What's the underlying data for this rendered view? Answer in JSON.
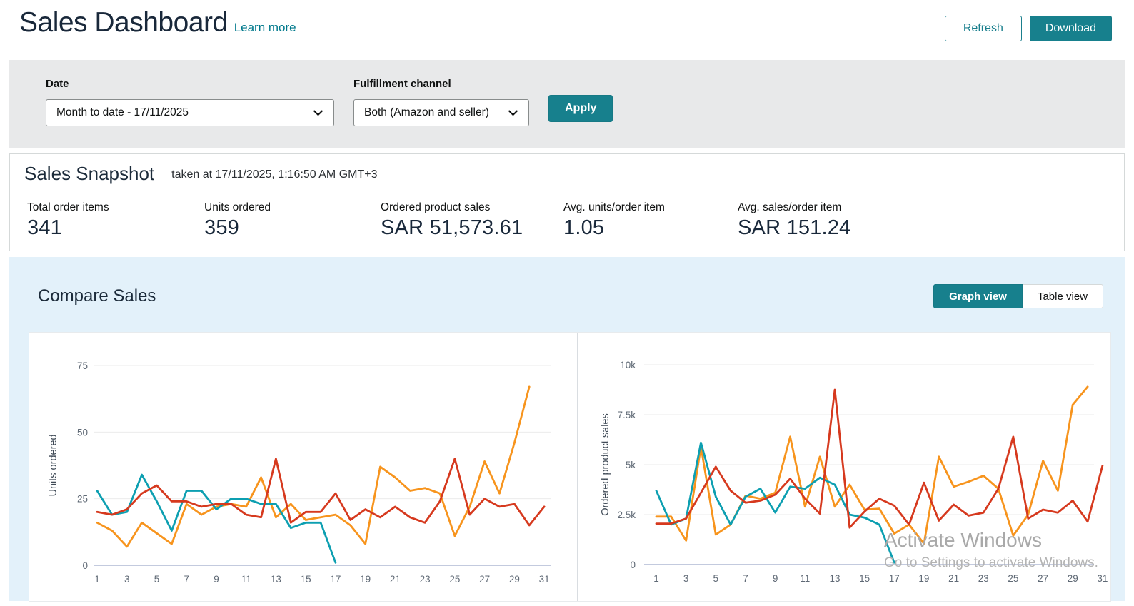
{
  "header": {
    "title": "Sales Dashboard",
    "learn_more": "Learn more",
    "refresh_label": "Refresh",
    "download_label": "Download"
  },
  "filters": {
    "date_label": "Date",
    "date_value": "Month to date - 17/11/2025",
    "channel_label": "Fulfillment channel",
    "channel_value": "Both (Amazon and seller)",
    "apply_label": "Apply"
  },
  "snapshot": {
    "title": "Sales Snapshot",
    "taken_at": "taken at 17/11/2025, 1:16:50 AM GMT+3",
    "stats": [
      {
        "label": "Total order items",
        "value": "341"
      },
      {
        "label": "Units ordered",
        "value": "359"
      },
      {
        "label": "Ordered product sales",
        "value": "SAR 51,573.61"
      },
      {
        "label": "Avg. units/order item",
        "value": "1.05"
      },
      {
        "label": "Avg. sales/order item",
        "value": "SAR 151.24"
      }
    ]
  },
  "compare": {
    "title": "Compare Sales",
    "graph_view_label": "Graph view",
    "table_view_label": "Table view"
  },
  "watermark": {
    "line1": "Activate Windows",
    "line2": "Go to Settings to activate Windows."
  },
  "colors": {
    "accent_teal": "#17808d",
    "series_teal": "#0d9fb1",
    "series_red": "#d6391e",
    "series_orange": "#f7941d"
  },
  "chart_data": [
    {
      "type": "line",
      "title": "",
      "xlabel": "",
      "ylabel": "Units ordered",
      "xticks": [
        1,
        3,
        5,
        7,
        9,
        11,
        13,
        15,
        17,
        19,
        21,
        23,
        25,
        27,
        29,
        31
      ],
      "xlim": [
        1,
        31
      ],
      "ylim": [
        0,
        75
      ],
      "yticks": [
        0,
        25,
        50,
        75
      ],
      "yticklabels": [
        "0",
        "25",
        "50",
        "75"
      ],
      "grid": true,
      "legend": "none",
      "series": [
        {
          "name": "orange",
          "color": "#f7941d",
          "values": [
            16,
            13,
            7,
            16,
            12,
            8,
            23,
            19,
            22,
            23,
            22,
            33,
            18,
            23,
            17,
            18,
            19,
            15,
            8,
            37,
            33,
            28,
            29,
            27,
            11,
            22,
            39,
            27,
            46,
            67
          ]
        },
        {
          "name": "teal",
          "color": "#0d9fb1",
          "values": [
            28,
            19,
            20,
            34,
            24,
            13,
            28,
            28,
            21,
            25,
            25,
            23,
            23,
            14,
            16,
            16,
            1
          ]
        },
        {
          "name": "red",
          "color": "#d6391e",
          "values": [
            20,
            19,
            21,
            27,
            30,
            24,
            24,
            22,
            23,
            23,
            19,
            18,
            40,
            16,
            20,
            20,
            27,
            17,
            21,
            18,
            22,
            18,
            16,
            24,
            40,
            19,
            25,
            22,
            23,
            15,
            22
          ]
        }
      ]
    },
    {
      "type": "line",
      "title": "",
      "xlabel": "",
      "ylabel": "Ordered product sales",
      "xticks": [
        1,
        3,
        5,
        7,
        9,
        11,
        13,
        15,
        17,
        19,
        21,
        23,
        25,
        27,
        29,
        31
      ],
      "xlim": [
        1,
        31
      ],
      "ylim": [
        0,
        10000
      ],
      "yticks": [
        0,
        2500,
        5000,
        7500,
        10000
      ],
      "yticklabels": [
        "0",
        "2.5k",
        "5k",
        "7.5k",
        "10k"
      ],
      "grid": true,
      "legend": "none",
      "series": [
        {
          "name": "orange",
          "color": "#f7941d",
          "values": [
            2400,
            2400,
            1200,
            5900,
            1500,
            2000,
            3450,
            3300,
            3600,
            6400,
            2900,
            5400,
            2900,
            4000,
            2750,
            2800,
            1550,
            2000,
            1050,
            5400,
            3900,
            4150,
            4450,
            3800,
            1450,
            2500,
            5200,
            3700,
            8000,
            8900
          ]
        },
        {
          "name": "teal",
          "color": "#0d9fb1",
          "values": [
            3700,
            2000,
            2300,
            6100,
            3400,
            2000,
            3400,
            3800,
            2600,
            3900,
            3800,
            4350,
            4000,
            2500,
            2350,
            2000,
            100
          ]
        },
        {
          "name": "red",
          "color": "#d6391e",
          "values": [
            2050,
            2050,
            2300,
            3600,
            4900,
            3700,
            3100,
            3200,
            3500,
            4300,
            3300,
            2550,
            8750,
            1850,
            2650,
            3300,
            2950,
            2000,
            4100,
            2200,
            3000,
            2450,
            2600,
            3800,
            6400,
            2300,
            2750,
            2600,
            3200,
            2150,
            4950
          ]
        }
      ]
    }
  ]
}
